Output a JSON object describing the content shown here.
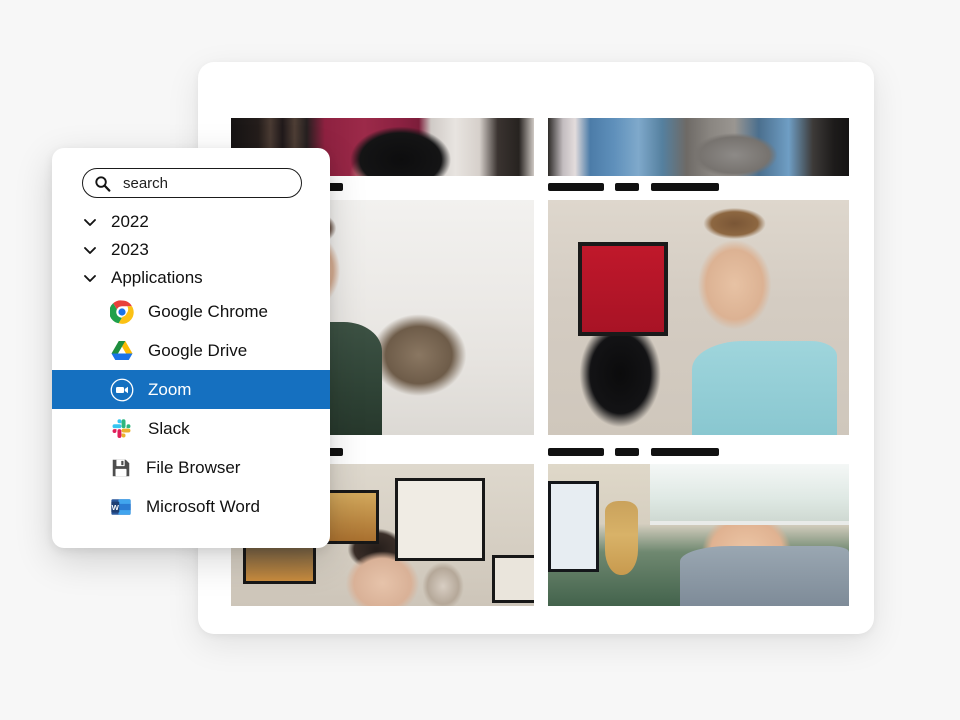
{
  "background_color": "#f7f7f7",
  "launcher": {
    "search": {
      "placeholder": "search",
      "value": "",
      "icon": "search-icon"
    },
    "groups": [
      {
        "label": "2022",
        "icon": "chevron-down-icon",
        "expanded": false
      },
      {
        "label": "2023",
        "icon": "chevron-down-icon",
        "expanded": false
      },
      {
        "label": "Applications",
        "icon": "chevron-down-icon",
        "expanded": true
      }
    ],
    "apps": [
      {
        "label": "Google Chrome",
        "icon": "google-chrome-icon",
        "selected": false
      },
      {
        "label": "Google Drive",
        "icon": "google-drive-icon",
        "selected": false
      },
      {
        "label": "Zoom",
        "icon": "zoom-icon",
        "selected": true
      },
      {
        "label": "Slack",
        "icon": "slack-icon",
        "selected": false
      },
      {
        "label": "File Browser",
        "icon": "floppy-disk-icon",
        "selected": false
      },
      {
        "label": "Microsoft Word",
        "icon": "microsoft-word-icon",
        "selected": false
      }
    ],
    "selection_color": "#1570c0",
    "selected_app": "Zoom"
  },
  "meeting": {
    "tiles": [
      {
        "position": "top-left",
        "scene": "person-maroon-shirt-with-black-cat",
        "name_redacted": true,
        "name_bar_widths": [
          52
        ]
      },
      {
        "position": "top-right",
        "scene": "person-denim-shirt-with-grey-cat",
        "name_redacted": true,
        "name_bar_widths": [
          56,
          24,
          68
        ]
      },
      {
        "position": "middle-left",
        "scene": "person-green-sweatshirt-with-tabby-cat",
        "name_redacted": true,
        "name_bar_widths": [
          52
        ]
      },
      {
        "position": "middle-right",
        "scene": "person-teal-polo-with-black-cat",
        "name_redacted": true,
        "name_bar_widths": [
          56,
          24,
          68
        ]
      },
      {
        "position": "bottom-left",
        "scene": "person-glasses-with-yawning-puppy",
        "name_redacted": false,
        "name_bar_widths": []
      },
      {
        "position": "bottom-right",
        "scene": "bearded-person-on-bed-with-dog",
        "name_redacted": false,
        "name_bar_widths": []
      }
    ]
  }
}
